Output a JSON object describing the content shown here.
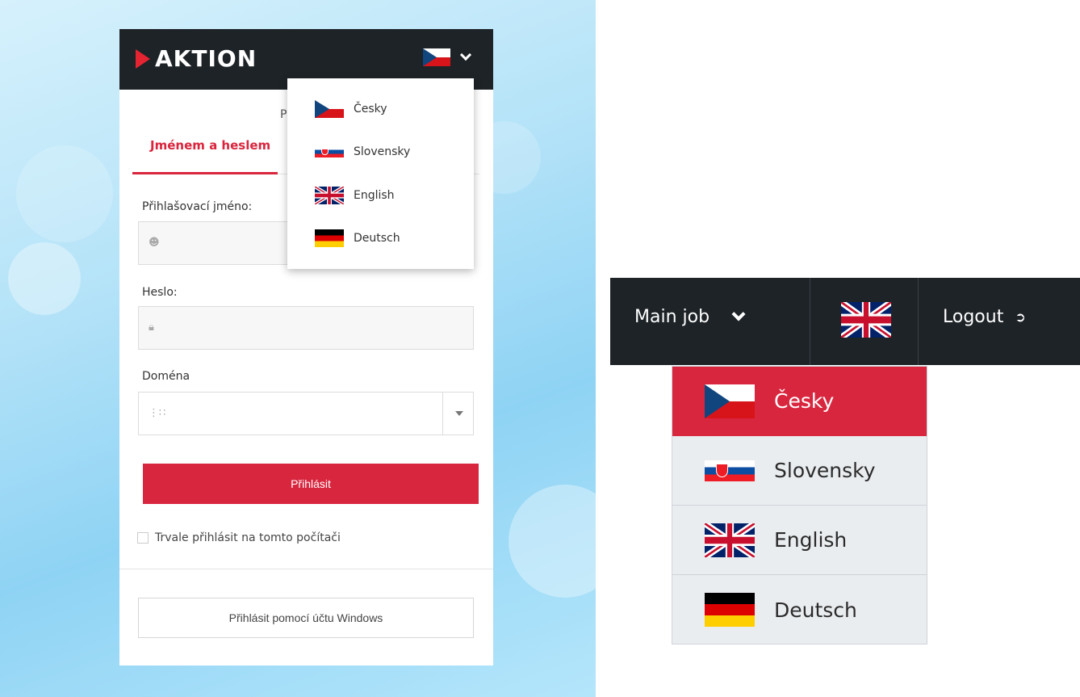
{
  "login": {
    "brand": "AKTION",
    "intro_text": "P",
    "tab_label": "Jménem a heslem",
    "username_label": "Přihlašovací jméno:",
    "username_value": "",
    "password_label": "Heslo:",
    "password_value": "",
    "domain_label": "Doména",
    "domain_value": "",
    "login_button": "Přihlásit",
    "remember_label": "Trvale přihlásit na tomto počítači",
    "windows_button": "Přihlásit pomocí účtu Windows",
    "current_language_flag": "flag-cz"
  },
  "language_popup": {
    "items": [
      {
        "label": "Česky",
        "flag": "flag-cz"
      },
      {
        "label": "Slovensky",
        "flag": "flag-sk"
      },
      {
        "label": "English",
        "flag": "flag-gb"
      },
      {
        "label": "Deutsch",
        "flag": "flag-de"
      }
    ]
  },
  "topbar": {
    "main_job_label": "Main job",
    "current_language_flag": "flag-gb",
    "logout_label": "Logout"
  },
  "language_list": {
    "selected": "Česky",
    "items": [
      {
        "label": "Česky",
        "flag": "flag-cz"
      },
      {
        "label": "Slovensky",
        "flag": "flag-sk"
      },
      {
        "label": "English",
        "flag": "flag-gb"
      },
      {
        "label": "Deutsch",
        "flag": "flag-de"
      }
    ]
  },
  "colors": {
    "accent_red": "#d9263f",
    "header_dark": "#1d2327",
    "logo_red": "#e52431"
  }
}
